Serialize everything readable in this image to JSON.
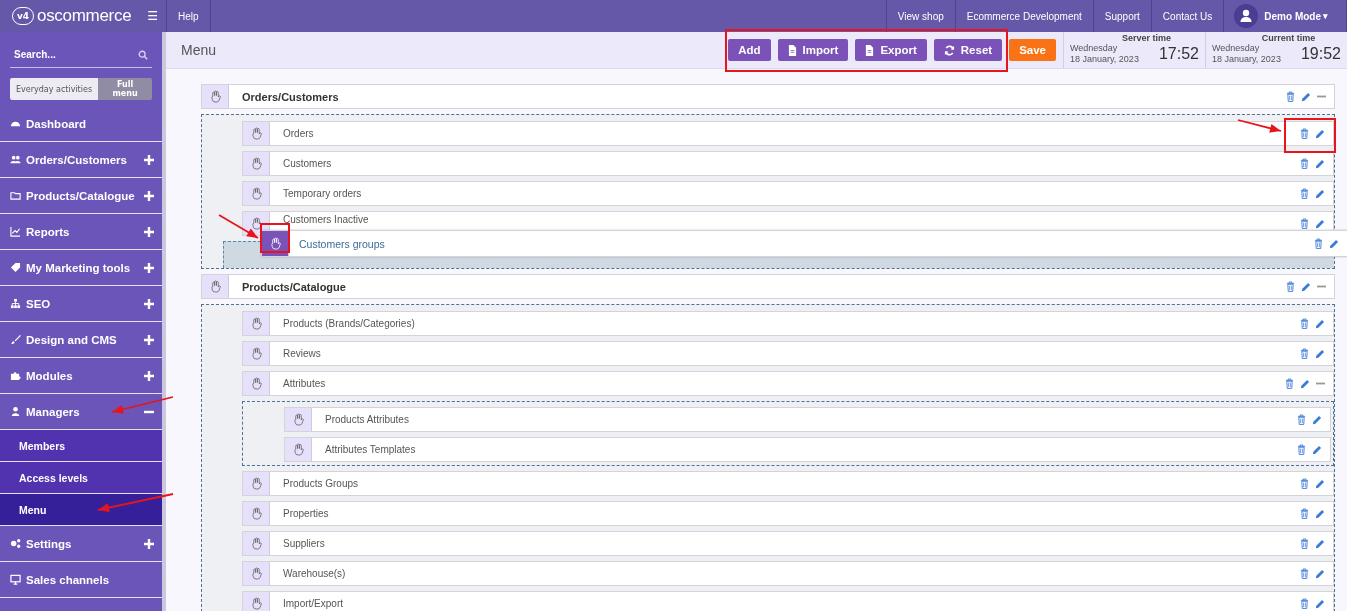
{
  "top_bar": {
    "logo_badge": "v4",
    "logo": "oscommerce",
    "menu_toggle": "☰",
    "help": "Help",
    "links": [
      "View shop",
      "Ecommerce Development",
      "Support",
      "Contact Us"
    ],
    "user": "Demo Mode",
    "user_caret": "▾"
  },
  "sidebar": {
    "search": {
      "placeholder": "Search..."
    },
    "modes": [
      {
        "label": "Everyday activities",
        "selected": false
      },
      {
        "label": "Full menu",
        "selected": true
      }
    ],
    "items": [
      {
        "label": "Dashboard",
        "kind": "link"
      },
      {
        "label": "Orders/Customers",
        "kind": "group",
        "expanded": false
      },
      {
        "label": "Products/Catalogue",
        "kind": "group",
        "expanded": false
      },
      {
        "label": "Reports",
        "kind": "group",
        "expanded": false
      },
      {
        "label": "My Marketing tools",
        "kind": "group",
        "expanded": false
      },
      {
        "label": "SEO",
        "kind": "group",
        "expanded": false
      },
      {
        "label": "Design and CMS",
        "kind": "group",
        "expanded": false
      },
      {
        "label": "Modules",
        "kind": "group",
        "expanded": false
      },
      {
        "label": "Managers",
        "kind": "group",
        "expanded": true,
        "children": [
          {
            "label": "Members",
            "selected": false
          },
          {
            "label": "Access levels",
            "selected": false
          },
          {
            "label": "Menu",
            "selected": true
          }
        ]
      },
      {
        "label": "Settings",
        "kind": "group",
        "expanded": false
      },
      {
        "label": "Sales channels",
        "kind": "link"
      }
    ]
  },
  "header": {
    "title": "Menu",
    "buttons": [
      {
        "label": "Add",
        "kind": "plain"
      },
      {
        "label": "Import",
        "kind": "file"
      },
      {
        "label": "Export",
        "kind": "file"
      },
      {
        "label": "Reset",
        "kind": "refresh"
      }
    ],
    "save": "Save",
    "clocks": [
      {
        "label": "Server time",
        "day": "Wednesday",
        "date": "18 January, 2023",
        "time": "17:52"
      },
      {
        "label": "Current time",
        "day": "Wednesday",
        "date": "18 January, 2023",
        "time": "19:52"
      }
    ]
  },
  "tree": [
    {
      "label": "Orders/Customers",
      "expanded": true,
      "dragging": "Customers groups",
      "children": [
        {
          "label": "Orders"
        },
        {
          "label": "Customers"
        },
        {
          "label": "Temporary orders"
        },
        {
          "label": "Customers Inactive"
        }
      ]
    },
    {
      "label": "Products/Catalogue",
      "expanded": true,
      "children": [
        {
          "label": "Products (Brands/Categories)"
        },
        {
          "label": "Reviews"
        },
        {
          "label": "Attributes",
          "expanded": true,
          "children": [
            {
              "label": "Products Attributes"
            },
            {
              "label": "Attributes Templates"
            }
          ]
        },
        {
          "label": "Products Groups"
        },
        {
          "label": "Properties"
        },
        {
          "label": "Suppliers"
        },
        {
          "label": "Warehouse(s)"
        },
        {
          "label": "Import/Export"
        }
      ]
    }
  ]
}
